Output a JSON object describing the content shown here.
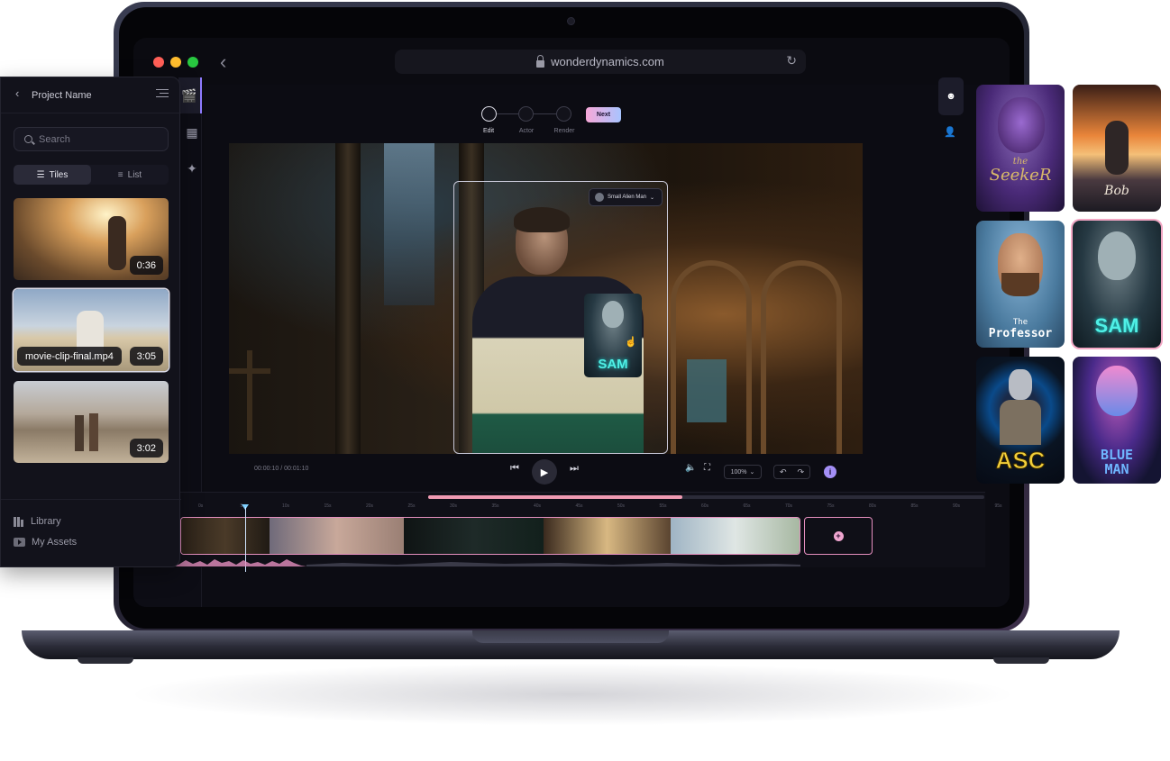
{
  "browser": {
    "url": "wonderdynamics.com"
  },
  "project_panel": {
    "project_name": "Project Name",
    "search_placeholder": "Search",
    "view_tiles_label": "Tiles",
    "view_list_label": "List",
    "clips": [
      {
        "duration": "0:36",
        "name": ""
      },
      {
        "duration": "3:05",
        "name": "movie-clip-final.mp4"
      },
      {
        "duration": "3:02",
        "name": ""
      }
    ],
    "library_label": "Library",
    "my_assets_label": "My Assets"
  },
  "stepper": {
    "steps": [
      "Edit",
      "Actor",
      "Render"
    ],
    "active_step": 0,
    "next_label": "Next"
  },
  "viewer": {
    "actor_select_label": "Small Alien Man",
    "overlay_card_label": "SAM"
  },
  "playback": {
    "current_time": "00:00:10",
    "separator": "/",
    "total_time": "00:01:10",
    "zoom_level": "100%"
  },
  "timeline": {
    "ruler_ticks": [
      "0s",
      "5s",
      "10s",
      "15s",
      "20s",
      "25s",
      "30s",
      "35s",
      "40s",
      "45s",
      "50s",
      "55s",
      "60s",
      "65s",
      "70s",
      "75s",
      "80s",
      "85s",
      "90s",
      "95s"
    ]
  },
  "characters": [
    {
      "name_line1": "the",
      "name_line2": "SeekeR",
      "color_accent": "#d8b86a"
    },
    {
      "name_line1": "",
      "name_line2": "Bob",
      "color_accent": "#f0e6d8"
    },
    {
      "name_line1": "The",
      "name_line2": "Professor",
      "color_accent": "#ffffff"
    },
    {
      "name_line1": "",
      "name_line2": "SAM",
      "color_accent": "#4ff0e6"
    },
    {
      "name_line1": "",
      "name_line2": "ASC",
      "color_accent": "#f2cf3a"
    },
    {
      "name_line1": "BLUE",
      "name_line2": "MAN",
      "color_accent": "#6fb6ff"
    }
  ],
  "colors": {
    "accent_pink": "#e58fbf",
    "accent_purple": "#a48ff6",
    "traffic_red": "#ff5f57",
    "traffic_yellow": "#febc2e",
    "traffic_green": "#28c840"
  }
}
